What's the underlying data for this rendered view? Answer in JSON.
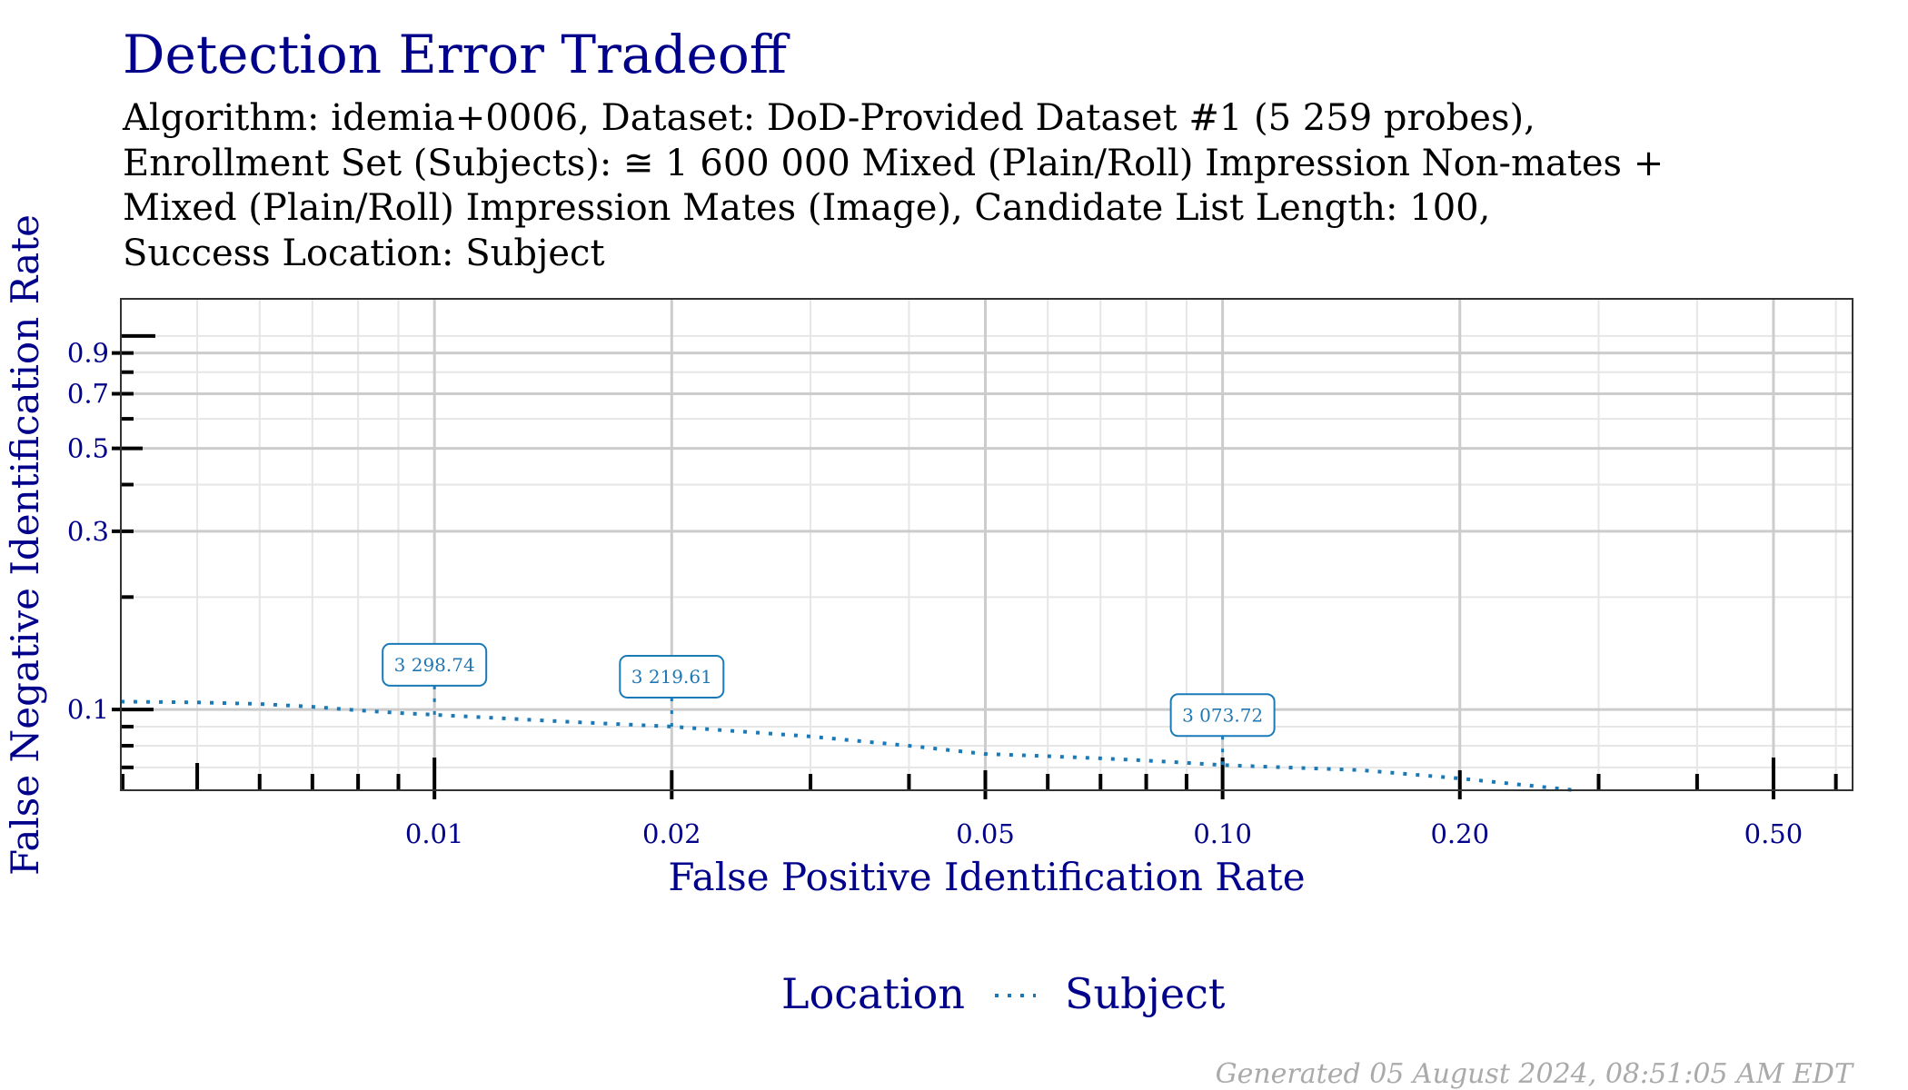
{
  "title": "Detection Error Tradeoff",
  "subtitle_lines": [
    "Algorithm: idemia+0006, Dataset: DoD-Provided Dataset #1 (5 259 probes),",
    "Enrollment Set (Subjects): ≅ 1 600 000 Mixed (Plain/Roll) Impression Non-mates +",
    "Mixed (Plain/Roll) Impression Mates (Image), Candidate List Length: 100,",
    "Success Location: Subject"
  ],
  "footer": "Generated 05 August 2024, 08:51:05 AM EDT",
  "colors": {
    "title": "#00008B",
    "series": "#1a7ab8",
    "grid_major": "#cccccc",
    "grid_minor": "#e6e6e6",
    "footer": "#aaaaaa"
  },
  "chart_data": {
    "type": "line",
    "title": "Detection Error Tradeoff",
    "xlabel": "False Positive Identification Rate",
    "ylabel": "False Negative Identification Rate",
    "xscale": "log",
    "yscale": "log",
    "xlim": [
      0.004,
      0.63
    ],
    "ylim": [
      0.0608,
      1.257
    ],
    "grid": true,
    "x_ticks": [
      0.01,
      0.02,
      0.05,
      0.1,
      0.2,
      0.5
    ],
    "x_tick_labels": [
      "0.01",
      "0.02",
      "0.05",
      "0.10",
      "0.20",
      "0.50"
    ],
    "x_minor_ticks": [
      0.004,
      0.005,
      0.006,
      0.007,
      0.008,
      0.009,
      0.03,
      0.04,
      0.06,
      0.07,
      0.08,
      0.09,
      0.3,
      0.4,
      0.6
    ],
    "y_ticks": [
      0.1,
      0.3,
      0.5,
      0.7,
      0.9
    ],
    "y_tick_labels": [
      "0.1",
      "0.3",
      "0.5",
      "0.7",
      "0.9"
    ],
    "y_minor_ticks": [
      0.07,
      0.08,
      0.09,
      0.2,
      0.4,
      0.6,
      0.8,
      1.0
    ],
    "legend": {
      "title": "Location",
      "placement": "bottom",
      "entries": [
        {
          "label": "Subject",
          "style": "dotted"
        }
      ]
    },
    "series": [
      {
        "name": "Subject",
        "style": "dotted",
        "x": [
          0.004,
          0.005,
          0.006,
          0.007,
          0.008,
          0.009,
          0.01,
          0.015,
          0.02,
          0.03,
          0.04,
          0.05,
          0.06,
          0.07,
          0.08,
          0.09,
          0.1,
          0.15,
          0.2,
          0.25,
          0.28
        ],
        "y": [
          0.105,
          0.1045,
          0.1035,
          0.1017,
          0.0995,
          0.0979,
          0.0968,
          0.0926,
          0.09,
          0.0847,
          0.08,
          0.076,
          0.075,
          0.074,
          0.073,
          0.072,
          0.071,
          0.0688,
          0.0654,
          0.0623,
          0.0608
        ]
      }
    ],
    "annotations": [
      {
        "x": 0.01,
        "y": 0.0968,
        "label": "3 298.74"
      },
      {
        "x": 0.02,
        "y": 0.09,
        "label": "3 219.61"
      },
      {
        "x": 0.1,
        "y": 0.071,
        "label": "3 073.72"
      }
    ]
  }
}
